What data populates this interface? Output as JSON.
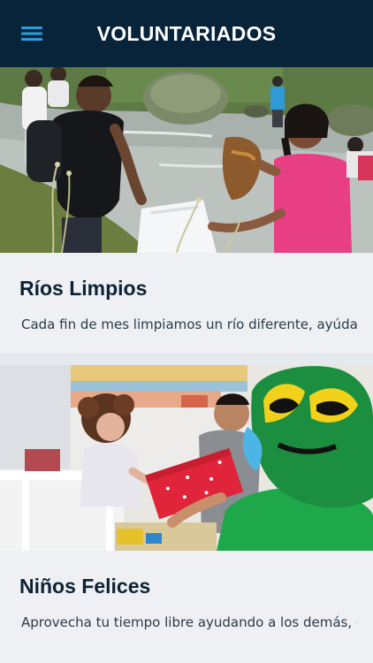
{
  "header": {
    "title": "VOLUNTARIADOS",
    "menu_icon": "hamburger-menu-icon",
    "background": "#08243a"
  },
  "cards": [
    {
      "title": "Ríos Limpios",
      "description": "Cada fin de mes limpiamos un río diferente, ayúdanos ...",
      "image": "volunteers-cleaning-river-photo"
    },
    {
      "title": "Niños Felices",
      "description": "Aprovecha tu tiempo libre ayudando a los demás, esta...",
      "image": "volunteers-with-child-in-hospital-photo"
    }
  ],
  "colors": {
    "accent": "#2b9fdc",
    "background": "#eef0f4",
    "title_text": "#0d2233"
  }
}
